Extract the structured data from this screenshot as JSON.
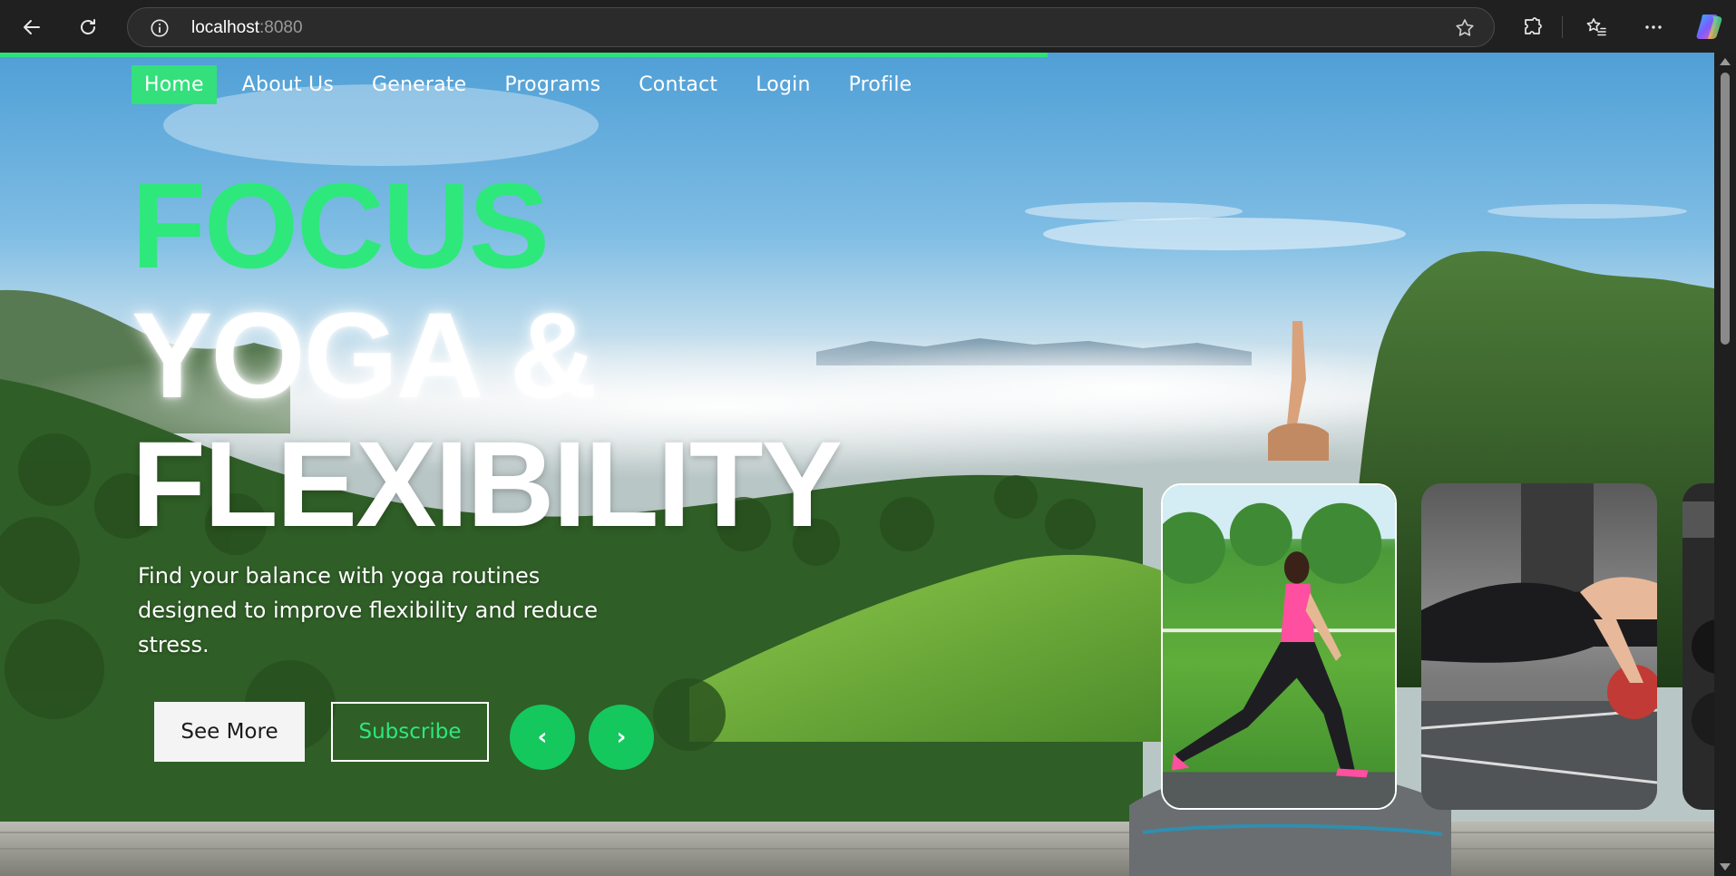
{
  "browser": {
    "url_host": "localhost",
    "url_port": ":8080"
  },
  "nav": {
    "items": [
      {
        "label": "Home",
        "active": true
      },
      {
        "label": "About Us",
        "active": false
      },
      {
        "label": "Generate",
        "active": false
      },
      {
        "label": "Programs",
        "active": false
      },
      {
        "label": "Contact",
        "active": false
      },
      {
        "label": "Login",
        "active": false
      },
      {
        "label": "Profile",
        "active": false
      }
    ]
  },
  "hero": {
    "title_line1": "FOCUS",
    "title_line2": "YOGA &",
    "title_line3": "FLEXIBILITY",
    "description": "Find your balance with yoga routines designed to improve flexibility and reduce stress.",
    "see_more": "See More",
    "subscribe": "Subscribe",
    "prev_symbol": "‹",
    "next_symbol": "›"
  },
  "cards": [
    {
      "icon": "yoga-lunge-photo"
    },
    {
      "icon": "fitness-pushup-photo"
    },
    {
      "icon": "gym-weights-photo"
    }
  ],
  "colors": {
    "accent": "#2ee87c",
    "button_green": "#14c85e",
    "load_bar": "#2ee07a"
  }
}
